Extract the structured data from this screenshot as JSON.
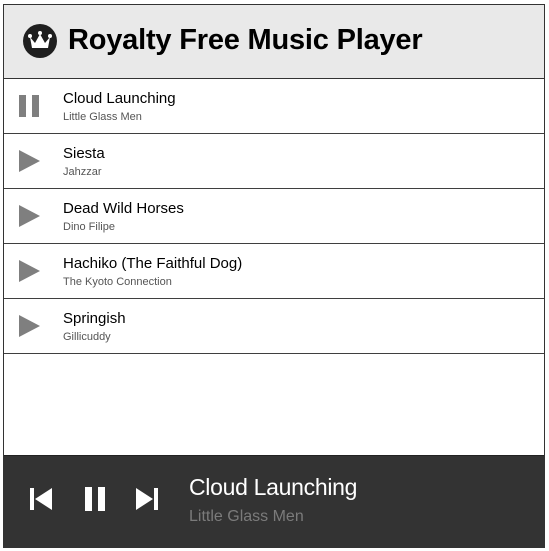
{
  "header": {
    "title": "Royalty Free Music Player",
    "logo_icon": "crown-icon"
  },
  "playlist": [
    {
      "title": "Cloud Launching",
      "artist": "Little Glass Men",
      "state": "playing",
      "icon": "pause-icon"
    },
    {
      "title": "Siesta",
      "artist": "Jahzzar",
      "state": "stopped",
      "icon": "play-icon"
    },
    {
      "title": "Dead Wild Horses",
      "artist": "Dino Filipe",
      "state": "stopped",
      "icon": "play-icon"
    },
    {
      "title": "Hachiko (The Faithful Dog)",
      "artist": "The Kyoto Connection",
      "state": "stopped",
      "icon": "play-icon"
    },
    {
      "title": "Springish",
      "artist": "Gillicuddy",
      "state": "stopped",
      "icon": "play-icon"
    }
  ],
  "player": {
    "now_playing_title": "Cloud Launching",
    "now_playing_artist": "Little Glass Men",
    "controls": [
      "previous-icon",
      "pause-icon",
      "next-icon"
    ]
  },
  "colors": {
    "header_bg": "#e9e9e9",
    "player_bg": "#333333",
    "icon_gray": "#7f7f7f",
    "control_white": "#ffffff",
    "artist_gray": "#7b7b7b"
  }
}
